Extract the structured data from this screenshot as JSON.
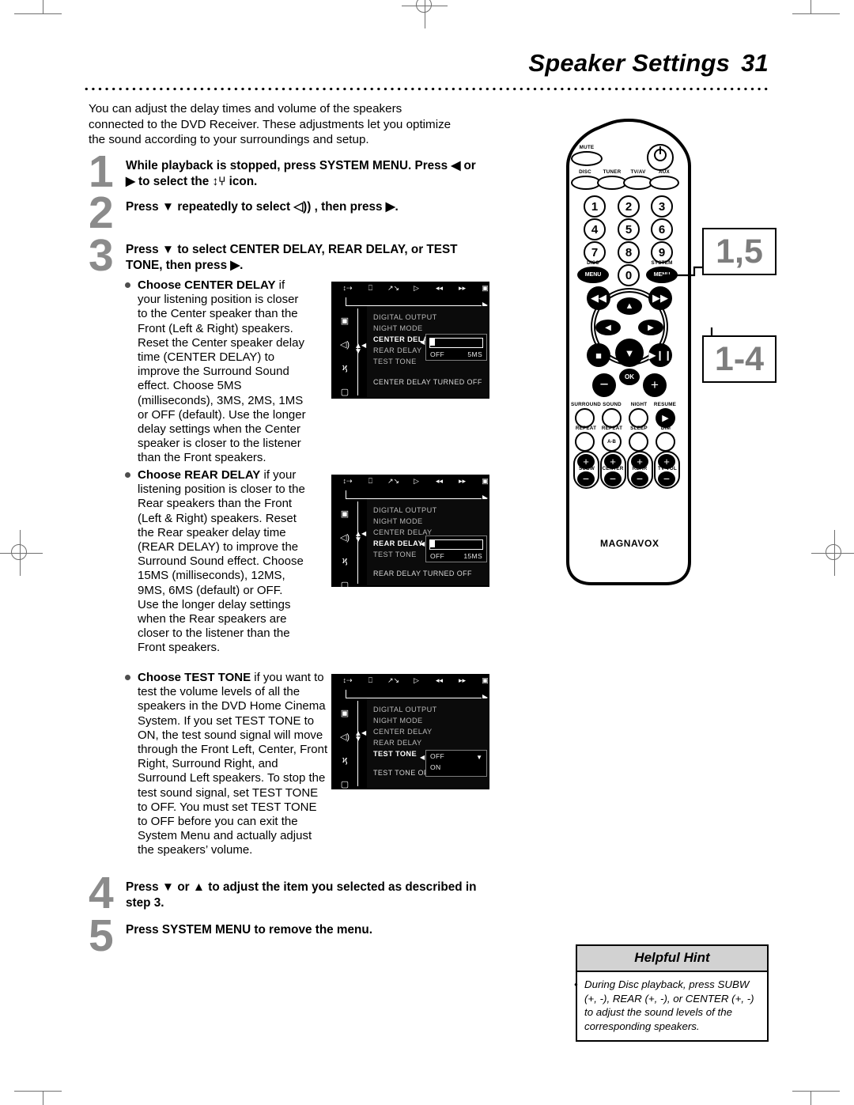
{
  "header": {
    "title": "Speaker Settings",
    "page_number": "31"
  },
  "intro": "You can adjust the delay times and volume of the speakers connected to the DVD Receiver. These adjustments let you optimize the sound according to your surroundings and setup.",
  "steps": [
    {
      "num": "1",
      "text": "While playback is stopped, press SYSTEM MENU. Press ◀ or ▶ to select the ↕⑂ icon."
    },
    {
      "num": "2",
      "text": "Press ▼ repeatedly to select ◁)) , then press ▶."
    },
    {
      "num": "3",
      "text": "Press ▼ to select CENTER DELAY, REAR DELAY, or TEST TONE, then press ▶."
    },
    {
      "num": "4",
      "text": "Press ▼ or ▲ to adjust the item you selected as described in step 3."
    },
    {
      "num": "5",
      "text": "Press SYSTEM MENU to remove the menu."
    }
  ],
  "bullets": [
    {
      "lead": "Choose CENTER DELAY",
      "lead_tail": " if",
      "body": "your listening position is closer to the Center speaker than the Front (Left & Right) speakers. Reset the Center speaker delay time (CENTER DELAY) to improve the Surround Sound effect. Choose 5MS (milliseconds), 3MS, 2MS, 1MS or OFF (default). Use the longer delay settings when the Center speaker is closer to the listener than the Front speakers."
    },
    {
      "lead": "Choose REAR DELAY",
      "lead_tail": " if",
      "body": "your listening position is closer to the Rear speakers than the Front (Left & Right) speakers. Reset the Rear speaker delay time (REAR DELAY) to improve the Surround Sound effect. Choose 15MS (milliseconds), 12MS, 9MS, 6MS (default) or OFF.\nUse the longer delay settings when the Rear speakers are closer to the listener than the Front speakers."
    },
    {
      "lead": "Choose TEST TONE",
      "lead_tail": " if you",
      "body": "want to test the volume levels of all the speakers in the DVD Home Cinema System. If you set TEST TONE to ON, the test sound signal will move through the Front Left, Center, Front Right, Surround Right, and Surround Left speakers. To stop the test sound signal, set TEST TONE to OFF. You must set TEST TONE to OFF before you can exit the System Menu and actually adjust the speakers’ volume."
    }
  ],
  "osd_common": {
    "top_icons": [
      "tuner-icon",
      "subtitle-icon",
      "audio-icon",
      "play-icon",
      "rewind-icon",
      "forward-icon",
      "display-icon"
    ],
    "left_icons": [
      "picture-icon",
      "speaker-icon",
      "language-icon",
      "feature-icon"
    ],
    "menu_items": [
      "DIGITAL OUTPUT",
      "NIGHT MODE",
      "CENTER DELAY",
      "REAR DELAY",
      "TEST TONE"
    ]
  },
  "osd_screens": [
    {
      "name": "center-delay",
      "selected": "CENTER DELAY",
      "control": "slider",
      "min_label": "OFF",
      "max_label": "5MS",
      "status": "CENTER DELAY TURNED OFF"
    },
    {
      "name": "rear-delay",
      "selected": "REAR DELAY",
      "control": "slider",
      "min_label": "OFF",
      "max_label": "15MS",
      "status": "REAR DELAY TURNED OFF"
    },
    {
      "name": "test-tone",
      "selected": "TEST TONE",
      "control": "dropdown",
      "options": [
        "OFF",
        "ON"
      ],
      "status": "TEST TONE OFF"
    }
  ],
  "remote": {
    "brand": "MAGNAVOX",
    "mute_label": "MUTE",
    "power_icon": "power-icon",
    "source_buttons": [
      "DISC",
      "TUNER",
      "TV/AV",
      "AUX"
    ],
    "numbers": [
      "1",
      "2",
      "3",
      "4",
      "5",
      "6",
      "7",
      "8",
      "9",
      "0"
    ],
    "disc_menu_label": "DISC",
    "disc_menu_text": "MENU",
    "system_menu_label": "SYSTEM",
    "system_menu_text": "MENU",
    "ok_label": "OK",
    "nav_icons": [
      "prev-icon",
      "next-icon",
      "up-icon",
      "left-icon",
      "right-icon",
      "down-icon",
      "stop-icon",
      "play-pause-icon",
      "minus-icon",
      "plus-icon"
    ],
    "function_row1": [
      "SURROUND",
      "SOUND",
      "NIGHT",
      "RESUME"
    ],
    "function_row2": [
      "REPEAT",
      "REPEAT",
      "SLEEP",
      "DIM"
    ],
    "repeat_ab": "A-B",
    "volume_pairs": [
      "SUBW",
      "CENTER",
      "REAR",
      "TV VOL"
    ]
  },
  "callouts": [
    {
      "name": "callout-system-menu",
      "text": "1,5"
    },
    {
      "name": "callout-navigation",
      "text": "1-4"
    }
  ],
  "hint": {
    "title": "Helpful Hint",
    "text": "During Disc playback, press SUBW (+, -), REAR (+, -), or CENTER (+, -) to adjust the sound levels of the corresponding speakers."
  }
}
